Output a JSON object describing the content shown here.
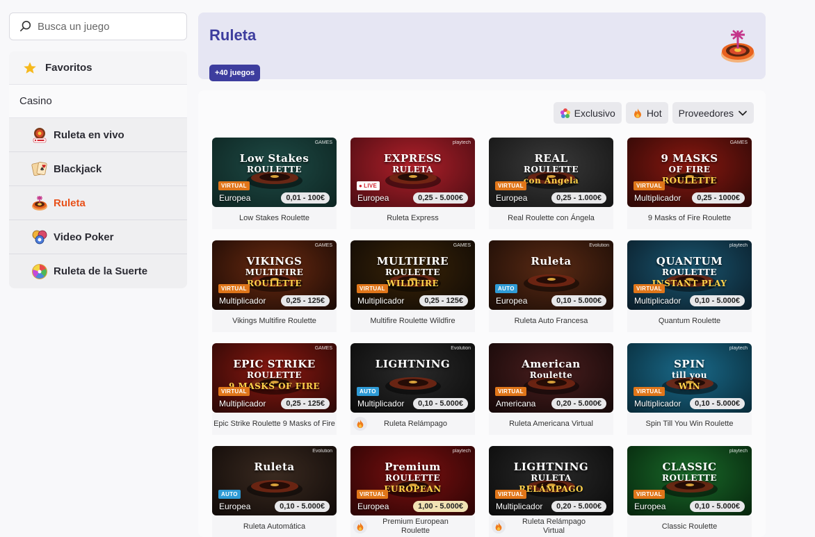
{
  "search": {
    "placeholder": "Busca un juego"
  },
  "sidebar": {
    "favorites_label": "Favoritos",
    "section_label": "Casino",
    "items": [
      {
        "label": "Ruleta en vivo",
        "icon": "live-roulette-icon"
      },
      {
        "label": "Blackjack",
        "icon": "cards-icon"
      },
      {
        "label": "Ruleta",
        "icon": "roulette-icon",
        "active": true
      },
      {
        "label": "Video Poker",
        "icon": "poker-chips-icon"
      },
      {
        "label": "Ruleta de la Suerte",
        "icon": "wheel-of-fortune-icon"
      }
    ]
  },
  "header": {
    "title": "Ruleta",
    "count_badge": "+40 juegos"
  },
  "filters": {
    "exclusive": "Exclusivo",
    "hot": "Hot",
    "providers": "Proveedores"
  },
  "colors": {
    "accent": "#3d3d9e",
    "active": "#e8511a",
    "virtual_tag": "#e0761a",
    "auto_tag": "#2f9bd6"
  },
  "games": [
    {
      "name": "Low Stakes Roulette",
      "art": "Low Stakes",
      "art2": "ROULETTE",
      "tag": "VIRTUAL",
      "tag_type": "virtual",
      "variant": "Europea",
      "stake": "0,01 - 100€",
      "provider": "GAMES",
      "bg": "#1e4a45,#0d2421"
    },
    {
      "name": "Ruleta Express",
      "art": "EXPRESS",
      "art2": "RULETA",
      "tag": "LIVE",
      "tag_type": "live",
      "variant": "Europea",
      "stake": "0,25 - 5.000€",
      "provider": "playtech",
      "bg": "#b0202a,#4a0c12"
    },
    {
      "name": "Real Roulette con Ángela",
      "art": "REAL",
      "art2": "ROULETTE",
      "art3": "con Ángela",
      "tag": "VIRTUAL",
      "tag_type": "virtual",
      "variant": "Europea",
      "stake": "0,25 - 1.000€",
      "provider": "",
      "bg": "#3a3a3a,#141414"
    },
    {
      "name": "9 Masks of Fire Roulette",
      "art": "9 MASKS",
      "art2": "OF FIRE",
      "art3": "ROULETTE",
      "tag": "VIRTUAL",
      "tag_type": "virtual",
      "variant": "Multiplicador",
      "stake": "0,25 - 1000€",
      "provider": "GAMES",
      "bg": "#8a1810,#2a0806"
    },
    {
      "name": "Vikings Multifire Roulette",
      "art": "VIKINGS",
      "art2": "MULTIFIRE",
      "art3": "ROULETTE",
      "tag": "VIRTUAL",
      "tag_type": "virtual",
      "variant": "Multiplicador",
      "stake": "0,25 - 125€",
      "provider": "GAMES",
      "bg": "#6a2a10,#1a0a05"
    },
    {
      "name": "Multifire Roulette Wildfire",
      "art": "MULTIFIRE",
      "art2": "ROULETTE",
      "art3": "WILDFIRE",
      "tag": "VIRTUAL",
      "tag_type": "virtual",
      "variant": "Multiplicador",
      "stake": "0,25 - 125€",
      "provider": "GAMES",
      "bg": "#3a2408,#0e0904"
    },
    {
      "name": "Ruleta Auto Francesa",
      "art": "Ruleta",
      "tag": "AUTO",
      "tag_type": "auto",
      "variant": "Europea",
      "stake": "0,10 - 5.000€",
      "provider": "Evolution",
      "bg": "#5a2a14,#1a0c06"
    },
    {
      "name": "Quantum Roulette",
      "art": "QUANTUM",
      "art2": "ROULETTE",
      "art3": "INSTANT PLAY",
      "tag": "VIRTUAL",
      "tag_type": "virtual",
      "variant": "Multiplicador",
      "stake": "0,10 - 5.000€",
      "provider": "playtech",
      "bg": "#1a5670,#0a1c28"
    },
    {
      "name": "Epic Strike Roulette 9 Masks of Fire",
      "art": "EPIC STRIKE",
      "art2": "ROULETTE",
      "art3": "9 MASKS OF FIRE",
      "tag": "VIRTUAL",
      "tag_type": "virtual",
      "variant": "Multiplicador",
      "stake": "0,25 - 125€",
      "provider": "GAMES",
      "bg": "#8a1810,#2a0806"
    },
    {
      "name": "Ruleta Relámpago",
      "art": "LIGHTNING",
      "tag": "AUTO",
      "tag_type": "auto",
      "variant": "Multiplicador",
      "stake": "0,10 - 5.000€",
      "provider": "Evolution",
      "bg": "#2a2a2a,#0a0a0a",
      "hot": true
    },
    {
      "name": "Ruleta Americana Virtual",
      "art": "American",
      "art2": "Roulette",
      "tag": "VIRTUAL",
      "tag_type": "virtual",
      "variant": "Americana",
      "stake": "0,20 - 5.000€",
      "provider": "",
      "bg": "#4a1e1e,#140808"
    },
    {
      "name": "Spin Till You Win Roulette",
      "art": "SPIN",
      "art2": "till you",
      "art3": "WIN",
      "tag": "VIRTUAL",
      "tag_type": "virtual",
      "variant": "Multiplicador",
      "stake": "0,10 - 5.000€",
      "provider": "playtech",
      "bg": "#1a6a8a,#082a38"
    },
    {
      "name": "Ruleta Automática",
      "art": "Ruleta",
      "tag": "AUTO",
      "tag_type": "auto",
      "variant": "Europea",
      "stake": "0,10 - 5.000€",
      "provider": "Evolution",
      "bg": "#3a2a20,#100a08"
    },
    {
      "name": "Premium European Roulette",
      "art": "Premium",
      "art2": "ROULETTE",
      "art3": "EUROPEAN",
      "tag": "VIRTUAL",
      "tag_type": "virtual",
      "variant": "Europea",
      "stake": "1,00 - 5.000€",
      "stake_style": "gold",
      "provider": "playtech",
      "bg": "#7a1010,#2a0404",
      "hot": true
    },
    {
      "name": "Ruleta Relámpago Virtual",
      "art": "LIGHTNING",
      "art2": "RULETA",
      "art3": "RELÁMPAGO",
      "tag": "VIRTUAL",
      "tag_type": "virtual",
      "variant": "Multiplicador",
      "stake": "0,20 - 5.000€",
      "provider": "",
      "bg": "#2a2a2a,#0a0a0a",
      "hot": true
    },
    {
      "name": "Classic Roulette",
      "art": "CLASSIC",
      "art2": "ROULETTE",
      "tag": "VIRTUAL",
      "tag_type": "virtual",
      "variant": "Europea",
      "stake": "0,10 - 5.000€",
      "provider": "playtech",
      "bg": "#1a6a2a,#06240c"
    }
  ]
}
